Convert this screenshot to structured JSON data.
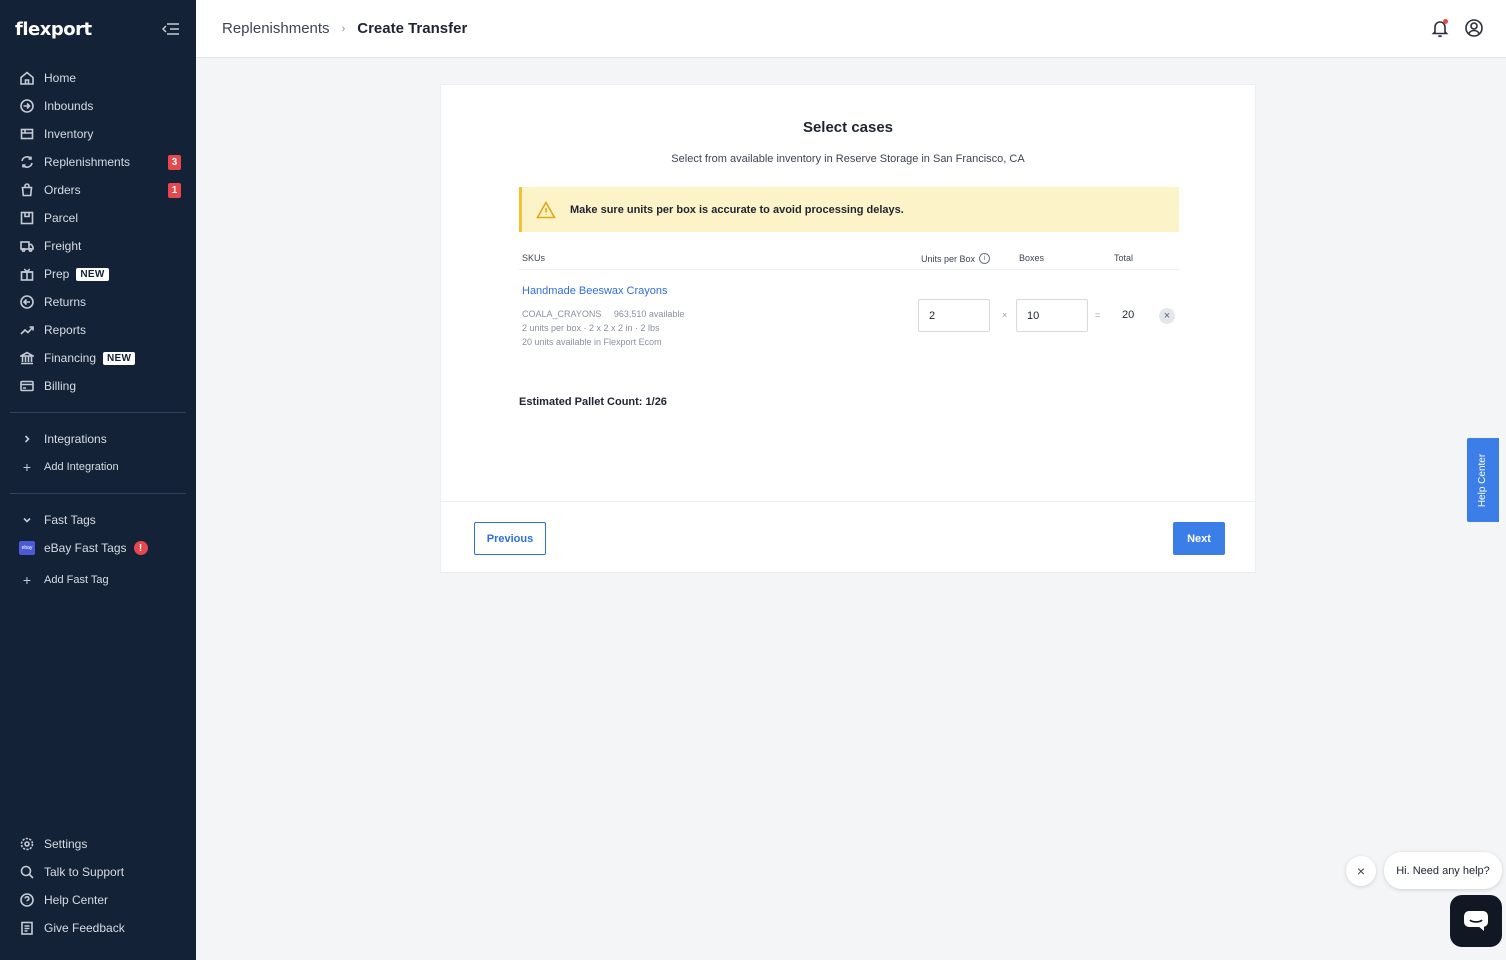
{
  "brand": {
    "logo": "flexport"
  },
  "sidebar": {
    "items": [
      {
        "label": "Home",
        "icon": "home-icon"
      },
      {
        "label": "Inbounds",
        "icon": "inbound-icon"
      },
      {
        "label": "Inventory",
        "icon": "inventory-icon"
      },
      {
        "label": "Replenishments",
        "icon": "replenish-icon",
        "badge": "3"
      },
      {
        "label": "Orders",
        "icon": "orders-icon",
        "badge": "1"
      },
      {
        "label": "Parcel",
        "icon": "parcel-icon"
      },
      {
        "label": "Freight",
        "icon": "freight-icon"
      },
      {
        "label": "Prep",
        "icon": "prep-icon",
        "tag": "NEW"
      },
      {
        "label": "Returns",
        "icon": "returns-icon"
      },
      {
        "label": "Reports",
        "icon": "reports-icon"
      },
      {
        "label": "Financing",
        "icon": "financing-icon",
        "tag": "NEW"
      },
      {
        "label": "Billing",
        "icon": "billing-icon"
      }
    ],
    "integrations": {
      "label": "Integrations",
      "add": "Add Integration"
    },
    "fast_tags": {
      "label": "Fast Tags",
      "ebay": "eBay Fast Tags",
      "ebay_icon_text": "ebay",
      "alert": "!",
      "add": "Add Fast Tag"
    },
    "bottom": [
      {
        "label": "Settings"
      },
      {
        "label": "Talk to Support"
      },
      {
        "label": "Help Center"
      },
      {
        "label": "Give Feedback"
      }
    ]
  },
  "header": {
    "breadcrumb_parent": "Replenishments",
    "breadcrumb_sep": "›",
    "breadcrumb_current": "Create Transfer"
  },
  "card": {
    "title": "Select cases",
    "subtitle": "Select from available inventory in Reserve Storage in San Francisco, CA",
    "warning": "Make sure units per box is accurate to avoid processing delays.",
    "columns": {
      "sku": "SKUs",
      "units": "Units per Box",
      "boxes": "Boxes",
      "total": "Total"
    },
    "row": {
      "name": "Handmade Beeswax Crayons",
      "code": "COALA_CRAYONS",
      "available": "963,510 available",
      "details": "2 units per box · 2 x 2 x 2 in · 2 lbs",
      "ecom": "20 units available in Flexport Ecom",
      "units_per_box": "2",
      "boxes": "10",
      "times": "×",
      "equals": "=",
      "total": "20"
    },
    "pallet": "Estimated Pallet Count: 1/26",
    "prev": "Previous",
    "next": "Next"
  },
  "help_tab": "Help Center",
  "chat": {
    "bubble": "Hi. Need any help?",
    "close": "×"
  },
  "colors": {
    "sidebar": "#142238",
    "accent": "#3b7ee8",
    "badge": "#e5484d",
    "warning_bg": "#fdf3c8"
  }
}
